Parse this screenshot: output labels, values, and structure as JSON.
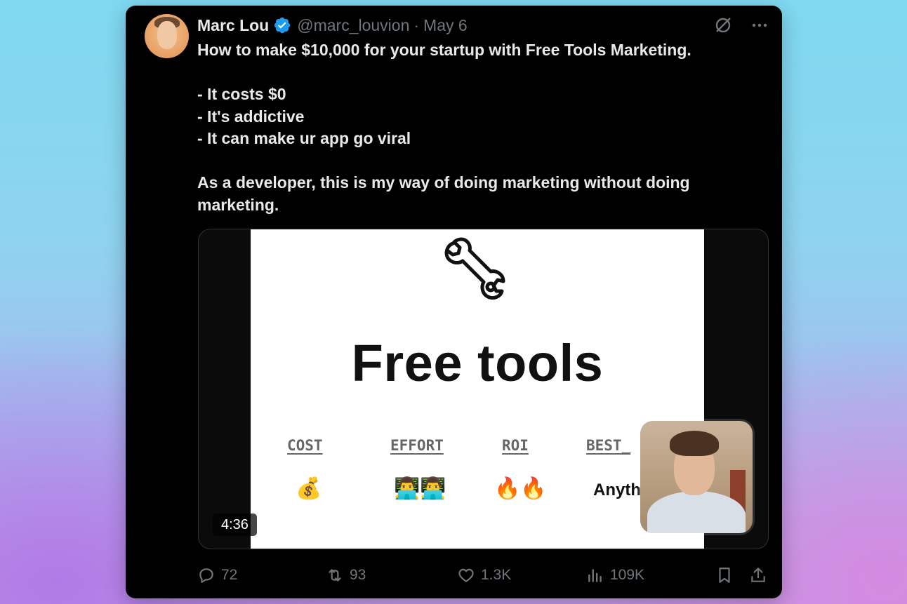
{
  "tweet": {
    "author_name": "Marc Lou",
    "handle": "@marc_louvion",
    "separator": "·",
    "date": "May 6",
    "lines": [
      "How to make $10,000 for your startup with Free Tools Marketing.",
      "",
      "- It costs $0",
      "- It's addictive",
      "- It can make ur app go viral",
      "",
      "As a developer, this is my way of doing marketing without doing",
      "marketing."
    ]
  },
  "video": {
    "slide_title": "Free tools",
    "columns": [
      {
        "header": "COST",
        "value": "💰"
      },
      {
        "header": "EFFORT",
        "value": "👨‍💻👨‍💻"
      },
      {
        "header": "ROI",
        "value": "🔥🔥"
      },
      {
        "header": "BEST_",
        "value": "Anyth"
      }
    ],
    "duration": "4:36"
  },
  "actions": {
    "replies": "72",
    "reposts": "93",
    "likes": "1.3K",
    "views": "109K"
  },
  "icons": {
    "verified": "verified-badge-icon",
    "grok": "grok-icon",
    "more": "more-icon",
    "reply": "reply-icon",
    "repost": "repost-icon",
    "like": "like-icon",
    "views": "views-icon",
    "bookmark": "bookmark-icon",
    "share": "share-icon"
  },
  "colors": {
    "card_bg": "#000000",
    "text_primary": "#e7e9ea",
    "text_secondary": "#71767b",
    "verified_blue": "#1d9bf0"
  }
}
